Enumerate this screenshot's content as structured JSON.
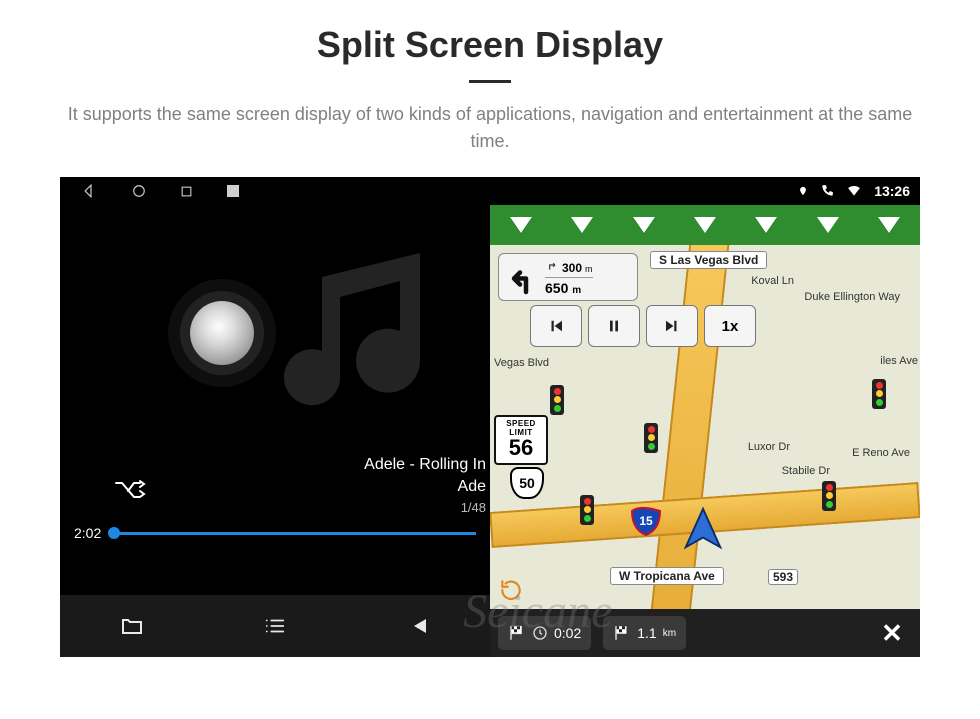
{
  "page": {
    "title": "Split Screen Display",
    "subtitle": "It supports the same screen display of two kinds of applications, navigation and entertainment at the same time."
  },
  "status_bar": {
    "time": "13:26"
  },
  "music": {
    "track_title": "Adele - Rolling In",
    "track_artist": "Ade",
    "track_index": "1/48",
    "elapsed": "2:02"
  },
  "nav": {
    "turn_primary_dist_value": "650",
    "turn_primary_dist_unit": "m",
    "turn_secondary_dist_value": "300",
    "turn_secondary_dist_unit": "m",
    "playback_speed": "1x",
    "speed_limit_label1": "SPEED",
    "speed_limit_label2": "LIMIT",
    "speed_limit_value": "56",
    "route_shield_50": "50",
    "interstate_15": "15",
    "bottom_time": "0:02",
    "bottom_dist_value": "1.1",
    "bottom_dist_unit": "km",
    "streets": {
      "las_vegas_blvd": "S Las Vegas Blvd",
      "tropicana": "W Tropicana Ave",
      "tropicana_num": "593",
      "koval": "Koval Ln",
      "duke": "Duke Ellington Way",
      "vegas_blvd": "Vegas Blvd",
      "luxor": "Luxor Dr",
      "reno": "E Reno Ave",
      "stabile": "Stabile Dr",
      "iles": "iles Ave"
    }
  },
  "watermark": "Seicane"
}
